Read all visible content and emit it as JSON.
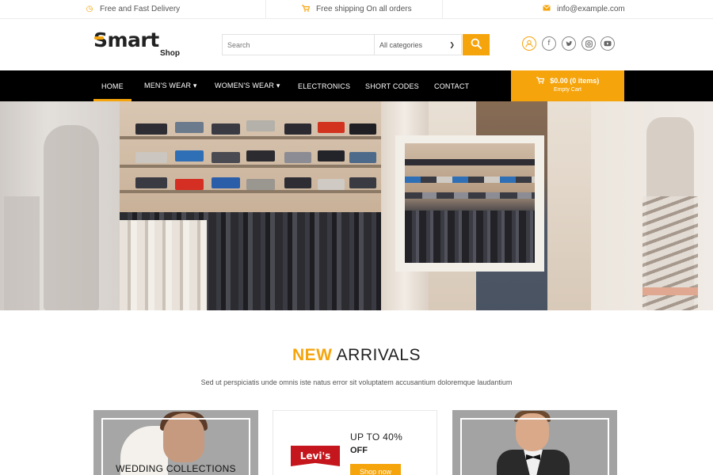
{
  "topbar": {
    "delivery": "Free and Fast Delivery",
    "shipping": "Free shipping On all orders",
    "email": "info@example.com"
  },
  "header": {
    "logo_word": "Smart",
    "logo_sub": "Shop",
    "search_placeholder": "Search",
    "category_selected": "All categories"
  },
  "nav": {
    "items": [
      {
        "label": "HOME"
      },
      {
        "label": "MEN'S WEAR ▾"
      },
      {
        "label": "WOMEN'S WEAR ▾"
      },
      {
        "label": "ELECTRONICS"
      },
      {
        "label": "SHORT CODES"
      },
      {
        "label": "CONTACT"
      }
    ],
    "active": "HOME"
  },
  "cart": {
    "total": "$0.00 (0 items)",
    "status": "Empty Cart"
  },
  "arrivals": {
    "title_accent": "NEW",
    "title_rest": "ARRIVALS",
    "subtitle": "Sed ut perspiciatis unde omnis iste natus error sit voluptatem accusantium doloremque laudantium"
  },
  "cards": {
    "wedding_label": "WEDDING COLLECTIONS",
    "brand": "Levi's",
    "promo": "UP TO 40%",
    "promo_off": "OFF",
    "shop_now": "Shop now"
  },
  "colors": {
    "accent": "#f5a40c",
    "nav_bg": "#000000",
    "brand_red": "#c4161c"
  },
  "icons": {
    "delivery": "clock-icon",
    "shipping": "cart-icon",
    "email": "envelope-icon",
    "social": [
      "user-icon",
      "facebook-icon",
      "twitter-icon",
      "instagram-icon",
      "youtube-icon"
    ]
  }
}
